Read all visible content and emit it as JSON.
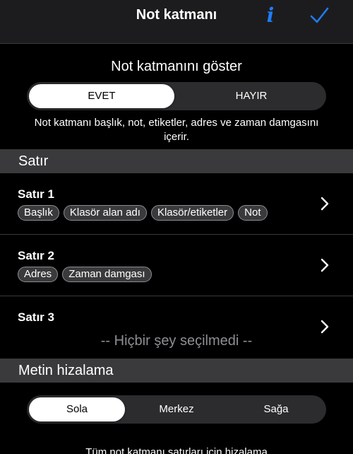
{
  "nav": {
    "title": "Not katmanı"
  },
  "overlay": {
    "title": "Not katmanını göster",
    "options": [
      "EVET",
      "HAYIR"
    ],
    "selected": "EVET",
    "description": "Not katmanı başlık, not, etiketler, adres ve zaman damgasını içerir."
  },
  "rows_section": {
    "header": "Satır",
    "rows": [
      {
        "title": "Satır 1",
        "chips": [
          "Başlık",
          "Klasör alan adı",
          "Klasör/etiketler",
          "Not"
        ]
      },
      {
        "title": "Satır 2",
        "chips": [
          "Adres",
          "Zaman damgası"
        ]
      },
      {
        "title": "Satır 3",
        "empty_text": "-- Hiçbir şey seçilmedi --"
      }
    ]
  },
  "alignment": {
    "header": "Metin hizalama",
    "options": [
      "Sola",
      "Merkez",
      "Sağa"
    ],
    "selected": "Sola",
    "footer_note": "Tüm not katmanı satırları için hizalama"
  },
  "colors": {
    "accent": "#1f7cf5",
    "background": "#000000",
    "section_header": "#3a3a3c",
    "segment_track": "#2c2c2e"
  }
}
